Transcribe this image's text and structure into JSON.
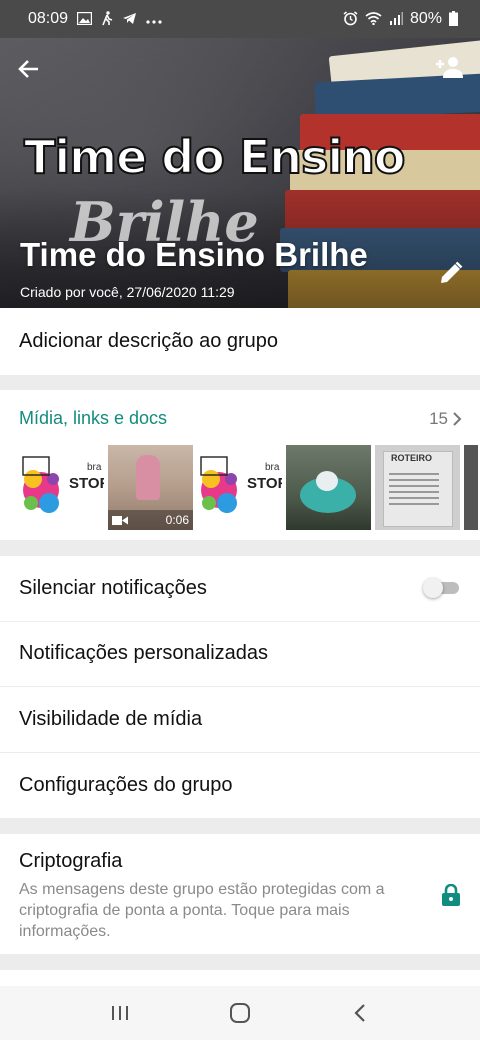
{
  "status_bar": {
    "time": "08:09",
    "left_icons": [
      "image-icon",
      "walking-icon",
      "telegram-icon",
      "more-dots-icon"
    ],
    "right_icons": [
      "alarm-icon",
      "wifi-icon",
      "signal-icon",
      "battery-icon"
    ],
    "battery": "80%"
  },
  "header": {
    "title": "Time do Ensino Brilhe",
    "subtitle": "Criado por você, 27/06/2020 11:29",
    "image_text_line1": "Time do Ensino",
    "image_text_line2": "Brilhe"
  },
  "description": {
    "label": "Adicionar descrição ao grupo"
  },
  "media": {
    "title": "Mídia, links e docs",
    "count": "15",
    "thumbnails": [
      {
        "kind": "image",
        "label": "STOR",
        "label_small": "bra"
      },
      {
        "kind": "video",
        "duration": "0:06"
      },
      {
        "kind": "image",
        "label": "STOR",
        "label_small": "bra"
      },
      {
        "kind": "image"
      },
      {
        "kind": "image",
        "label": "ROTEIRO"
      },
      {
        "kind": "image"
      }
    ]
  },
  "settings": {
    "mute": {
      "label": "Silenciar notificações",
      "enabled": false
    },
    "custom_notifications": {
      "label": "Notificações personalizadas"
    },
    "media_visibility": {
      "label": "Visibilidade de mídia"
    },
    "group_settings": {
      "label": "Configurações do grupo"
    }
  },
  "encryption": {
    "title": "Criptografia",
    "description": "As mensagens deste grupo estão protegidas com a criptografia de ponta a ponta. Toque para mais informações."
  },
  "colors": {
    "accent": "#128c7e",
    "lock": "#128c7e",
    "background": "#ececec"
  }
}
